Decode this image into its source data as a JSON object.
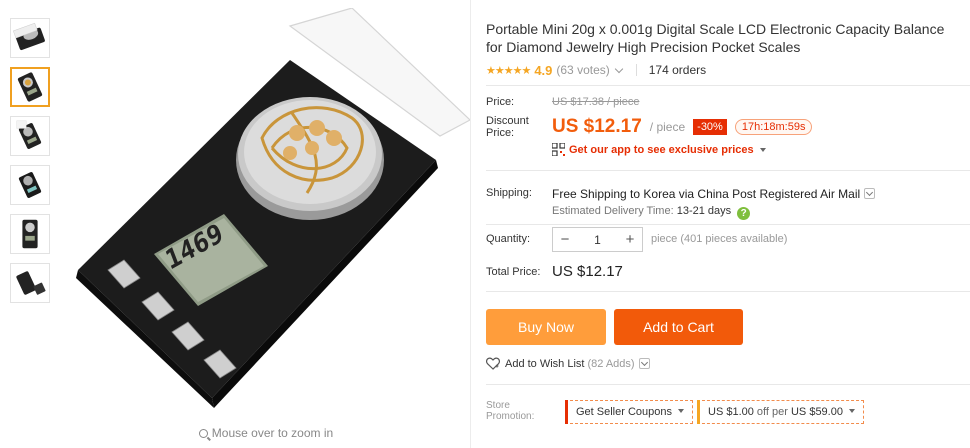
{
  "product": {
    "title": "Portable Mini 20g x 0.001g Digital Scale LCD Electronic Capacity Balance for Diamond Jewelry High Precision Pocket Scales",
    "rating": "4.9",
    "votes": "(63 votes)",
    "orders": "174 orders",
    "stars_glyph": "★★★★★"
  },
  "gallery": {
    "thumb_count": 6,
    "active_index": 1,
    "zoom_hint": "Mouse over to zoom in",
    "lcd_display": "1469"
  },
  "pricing": {
    "price_label": "Price:",
    "original_price": "US $17.38 / piece",
    "discount_label": "Discount Price:",
    "discount_price": "US $12.17",
    "per_piece": "/ piece",
    "discount_percent": "-30%",
    "countdown": "17h:18m:59s",
    "app_promo": "Get our app to see exclusive prices"
  },
  "shipping": {
    "label": "Shipping:",
    "main_text": "Free Shipping to Korea via China Post Registered Air Mail",
    "estimate_label": "Estimated Delivery Time:",
    "estimate_value": "13-21",
    "estimate_unit": "days"
  },
  "quantity": {
    "label": "Quantity:",
    "value": "1",
    "minus": "−",
    "plus": "+",
    "availability": "piece (401 pieces available)"
  },
  "total": {
    "label": "Total Price:",
    "value": "US $12.17"
  },
  "actions": {
    "buy_now": "Buy Now",
    "add_to_cart": "Add to Cart",
    "wish_list": "Add to Wish List",
    "wish_count": "(82 Adds)"
  },
  "promotion": {
    "label": "Store Promotion:",
    "seller_coupons": "Get Seller Coupons",
    "deal_prefix": "US $1.00",
    "deal_middle": " off per ",
    "deal_suffix": "US $59.00"
  },
  "colors": {
    "price_orange": "#f25d0c",
    "buy_now": "#ff9d3b",
    "add_to_cart": "#f25a0a",
    "discount_red": "#e62e04",
    "star": "#f5a623"
  }
}
